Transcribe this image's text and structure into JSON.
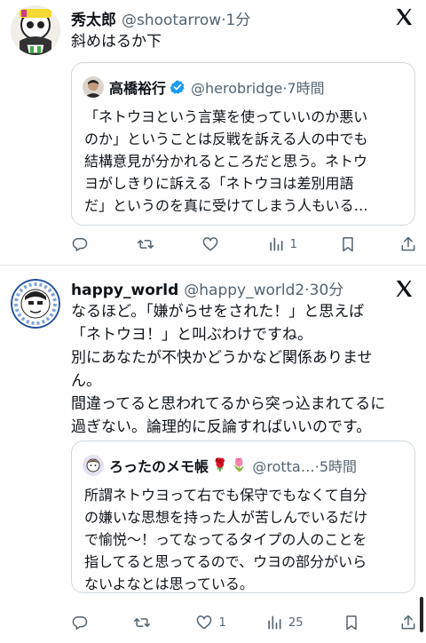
{
  "tweets": [
    {
      "author": "秀太郎",
      "handle": "@shootarrow",
      "time_sep": "·",
      "time": "1分",
      "text_lines": [
        "斜めはるか下"
      ],
      "quote": {
        "author": "高橋裕行",
        "verified": true,
        "handle": "@herobridge",
        "time_sep": "·",
        "time": "7時間",
        "text_lines": [
          "「ネトウヨという言葉を使っていいのか悪い",
          "のか」ということは反戦を訴える人の中でも",
          "結構意見が分かれるところだと思う。ネトウ",
          "ヨがしきりに訴える「ネトウヨは差別用語",
          "だ」というのを真に受けてしまう人もいる…"
        ]
      },
      "actions": {
        "reply": "",
        "retweet": "",
        "like": "",
        "views": "1"
      }
    },
    {
      "author": "happy_world",
      "handle": "@happy_world2",
      "time_sep": "·",
      "time": "30分",
      "text_lines": [
        "なるほど。「嫌がらせをされた！」と思えば",
        "「ネトウヨ！」と叫ぶわけですね。",
        "別にあなたが不快かどうかなど関係ありませ",
        "ん。",
        "間違ってると思われてるから突っ込まれてるに",
        "過ぎない。論理的に反論すればいいのです。"
      ],
      "quote": {
        "author": "ろったのメモ帳",
        "emojis": "🌹 🌷",
        "handle": "@rotta…",
        "time_sep": "·",
        "time": "5時間",
        "text_lines": [
          "所謂ネトウヨって右でも保守でもなくて自分",
          "の嫌いな思想を持った人が苦しんでいるだけ",
          "で愉悦〜！ってなってるタイプの人のことを",
          "指してると思ってるので、ウヨの部分がいら",
          "ないよなとは思っている。"
        ]
      },
      "actions": {
        "reply": "",
        "retweet": "",
        "like": "1",
        "views": "25"
      }
    }
  ],
  "colors": {
    "text": "#0f1419",
    "secondary": "#536471",
    "border": "#cfd9de",
    "verified": "#1d9bf0"
  },
  "icons": [
    "x-logo-icon",
    "reply-icon",
    "retweet-icon",
    "like-icon",
    "views-icon",
    "bookmark-icon",
    "share-icon",
    "verified-badge-icon"
  ]
}
